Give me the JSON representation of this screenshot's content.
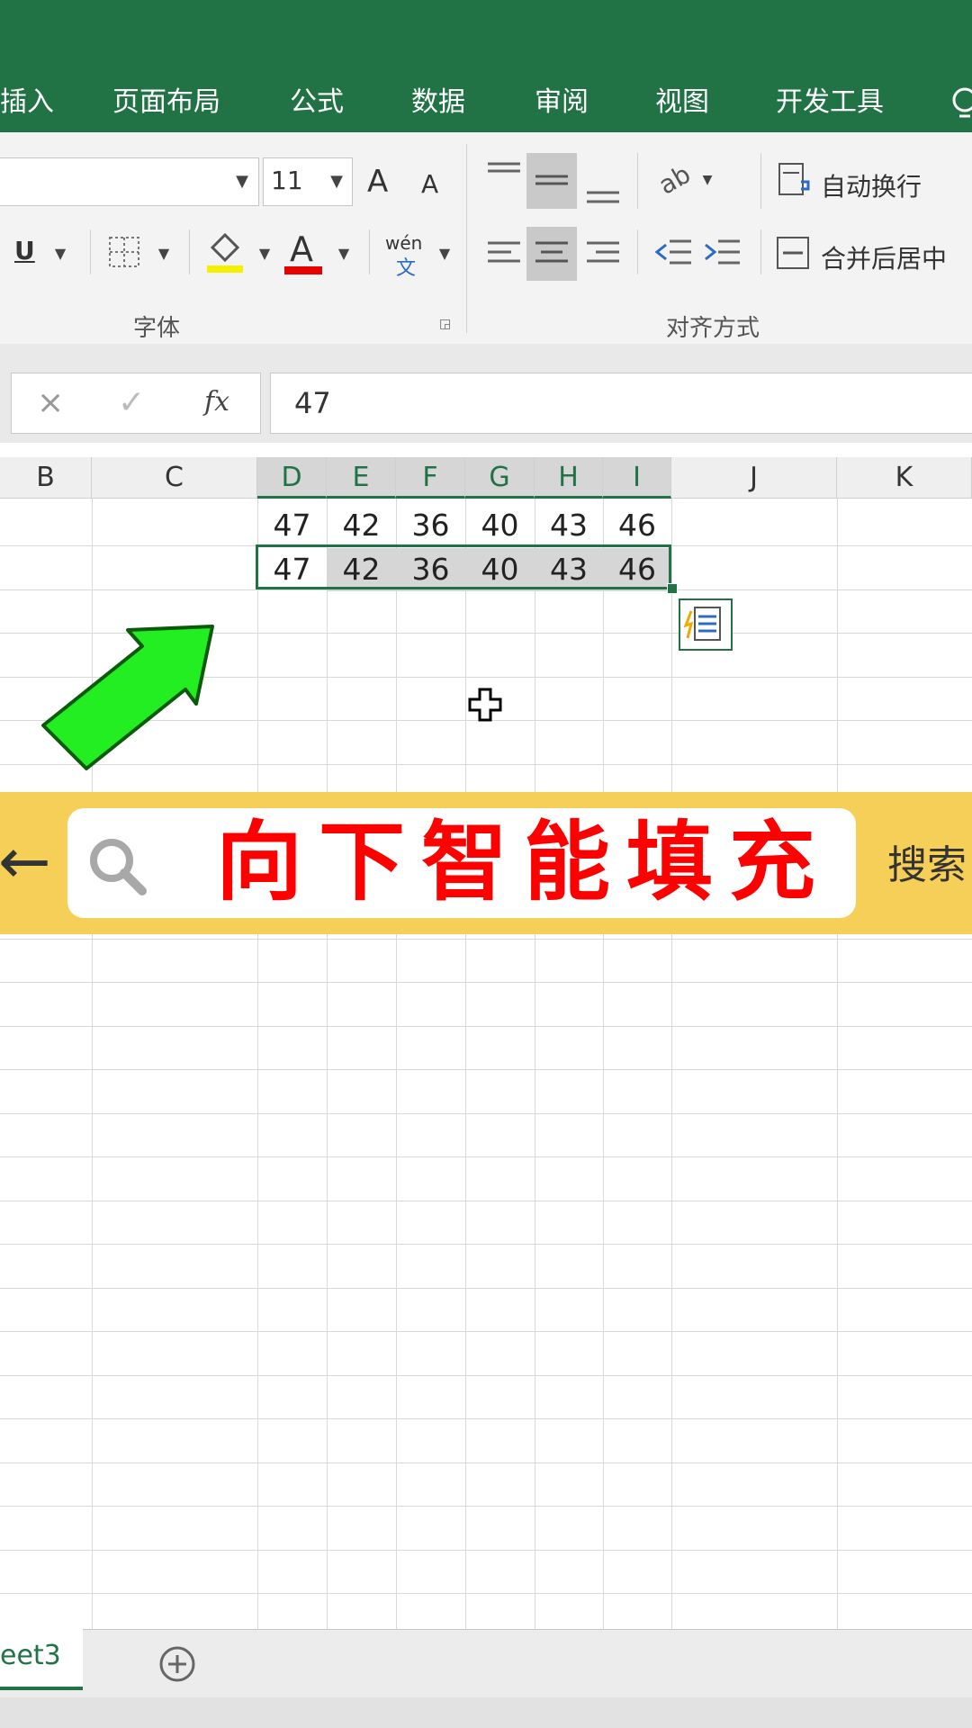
{
  "menu": {
    "items": [
      "插入",
      "页面布局",
      "公式",
      "数据",
      "审阅",
      "视图",
      "开发工具"
    ]
  },
  "ribbon": {
    "font_size": "11",
    "grow_font_label": "A",
    "shrink_font_label": "A",
    "underline_label": "U",
    "font_color_label": "A",
    "phonetic_top": "wén",
    "phonetic_bottom": "文",
    "wrap_text_label": "自动换行",
    "merge_center_label": "合并后居中",
    "font_group_label": "字体",
    "align_group_label": "对齐方式"
  },
  "formula_bar": {
    "cancel_symbol": "×",
    "enter_symbol": "✓",
    "fx_label": "fx",
    "value": "47"
  },
  "columns": [
    "B",
    "C",
    "D",
    "E",
    "F",
    "G",
    "H",
    "I",
    "J",
    "K"
  ],
  "rows": [
    [
      "47",
      "42",
      "36",
      "40",
      "43",
      "46"
    ],
    [
      "47",
      "42",
      "36",
      "40",
      "43",
      "46"
    ]
  ],
  "banner": {
    "back_symbol": "←",
    "headline": "向下智能填充",
    "search_label": "搜索"
  },
  "sheet_tabs": {
    "active": "eet3",
    "add_symbol": "+"
  },
  "colors": {
    "excel_green": "#217346",
    "banner_yellow": "#f5cf58",
    "headline_red": "#ff0000",
    "arrow_green": "#22ee22"
  },
  "icons": [
    "search-icon",
    "arrow-up-right-icon",
    "cell-cursor-icon",
    "flash-fill-icon",
    "lightbulb-icon"
  ]
}
